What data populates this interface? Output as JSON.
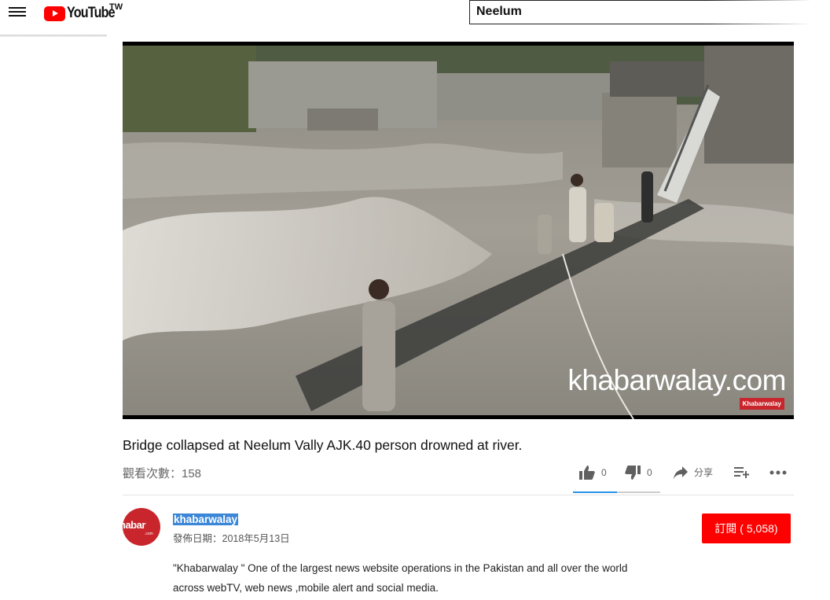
{
  "header": {
    "logo_text": "YouTube",
    "country_code": "TW",
    "search_value": "Neelum",
    "icons": {
      "menu": "hamburger-menu-icon",
      "logo": "youtube-play-icon"
    }
  },
  "video": {
    "watermark": "khabarwalay.com",
    "watermark_badge": "Khabarwalay"
  },
  "info": {
    "title": "Bridge collapsed at Neelum Vally AJK.40 person drowned at river.",
    "views": "觀看次數：158",
    "like_count": "0",
    "dislike_count": "0",
    "share_label": "分享",
    "colors": {
      "sentiment": "#2793e6"
    }
  },
  "owner": {
    "avatar_text": "habar",
    "avatar_sub": ".com",
    "name": "khabarwalay",
    "publish_date": "發佈日期：2018年5月13日",
    "subscribe_label": "訂閱 ( 5,058)",
    "colors": {
      "subscribe": "#ff0000",
      "brand": "#c8262c"
    }
  },
  "description": {
    "line1": "\"Khabarwalay \" One of the largest news website operations in the Pakistan and all over the world",
    "line2": "across webTV, web news ,mobile alert and social media."
  }
}
